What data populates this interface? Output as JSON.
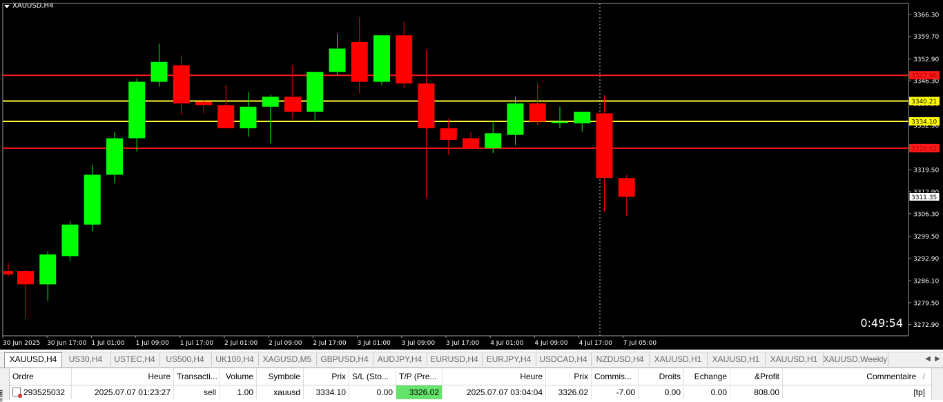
{
  "chart": {
    "symbol_title": "XAUUSD,H4",
    "countdown": "0:49:54",
    "price_axis": {
      "min": 3269.5,
      "max": 3369.6,
      "labels": [
        "3366.30",
        "3359.70",
        "3352.90",
        "3346.30",
        "3339.50",
        "3332.90",
        "3326.10",
        "3319.50",
        "3312.90",
        "3306.30",
        "3299.50",
        "3292.90",
        "3286.10",
        "3279.50",
        "3272.90"
      ]
    },
    "time_labels": [
      "30 Jun 2025",
      "30 Jun 17:00",
      "1 Jul 01:00",
      "1 Jul 09:00",
      "1 Jul 17:00",
      "2 Jul 01:00",
      "2 Jul 09:00",
      "2 Jul 17:00",
      "3 Jul 01:00",
      "3 Jul 09:00",
      "3 Jul 17:00",
      "4 Jul 01:00",
      "4 Jul 09:00",
      "4 Jul 17:00",
      "7 Jul 05:00"
    ],
    "levels": [
      {
        "label": "3347.96",
        "price": 3347.96,
        "color": "#ff1a1a",
        "badge_bg": "#ff1a1a",
        "badge_fg": "#b00000"
      },
      {
        "label": "3340.21",
        "price": 3340.21,
        "color": "#ffff33",
        "badge_bg": "#ffff00",
        "badge_fg": "#000000"
      },
      {
        "label": "3334.10",
        "price": 3334.1,
        "color": "#ffff33",
        "badge_bg": "#ffff00",
        "badge_fg": "#000000"
      },
      {
        "label": "3326.02",
        "price": 3326.02,
        "color": "#ff1a1a",
        "badge_bg": "#ff1a1a",
        "badge_fg": "#b00000"
      }
    ],
    "current_price": {
      "label": "3311.35",
      "price": 3311.35
    },
    "colors": {
      "bull": "#00ff00",
      "bear": "#ff0000",
      "background": "#000000",
      "axis_text": "#ffffff"
    },
    "candles": [
      {
        "o": 3289.0,
        "h": 3291.5,
        "l": 3287.5,
        "c": 3288.0
      },
      {
        "o": 3289.0,
        "h": 3289.5,
        "l": 3275.0,
        "c": 3285.0
      },
      {
        "o": 3285.0,
        "h": 3295.0,
        "l": 3280.0,
        "c": 3294.0
      },
      {
        "o": 3293.5,
        "h": 3304.0,
        "l": 3292.0,
        "c": 3303.0
      },
      {
        "o": 3303.0,
        "h": 3321.0,
        "l": 3301.0,
        "c": 3318.0
      },
      {
        "o": 3318.0,
        "h": 3331.0,
        "l": 3315.5,
        "c": 3329.0
      },
      {
        "o": 3329.0,
        "h": 3347.0,
        "l": 3325.0,
        "c": 3346.0
      },
      {
        "o": 3346.0,
        "h": 3357.5,
        "l": 3344.5,
        "c": 3352.0
      },
      {
        "o": 3351.0,
        "h": 3354.0,
        "l": 3336.0,
        "c": 3339.5
      },
      {
        "o": 3340.0,
        "h": 3340.5,
        "l": 3336.5,
        "c": 3339.0
      },
      {
        "o": 3339.0,
        "h": 3345.0,
        "l": 3332.0,
        "c": 3332.0
      },
      {
        "o": 3332.0,
        "h": 3343.0,
        "l": 3329.5,
        "c": 3338.5
      },
      {
        "o": 3338.5,
        "h": 3342.0,
        "l": 3327.5,
        "c": 3341.5
      },
      {
        "o": 3341.5,
        "h": 3351.0,
        "l": 3335.0,
        "c": 3337.0
      },
      {
        "o": 3337.0,
        "h": 3348.0,
        "l": 3334.0,
        "c": 3349.0
      },
      {
        "o": 3349.0,
        "h": 3360.5,
        "l": 3348.0,
        "c": 3356.0
      },
      {
        "o": 3358.0,
        "h": 3365.5,
        "l": 3342.5,
        "c": 3346.0
      },
      {
        "o": 3346.0,
        "h": 3360.0,
        "l": 3345.0,
        "c": 3360.0
      },
      {
        "o": 3360.0,
        "h": 3364.0,
        "l": 3344.0,
        "c": 3345.5
      },
      {
        "o": 3345.5,
        "h": 3355.5,
        "l": 3311.0,
        "c": 3332.0
      },
      {
        "o": 3332.0,
        "h": 3335.0,
        "l": 3324.0,
        "c": 3328.5
      },
      {
        "o": 3329.0,
        "h": 3331.0,
        "l": 3326.0,
        "c": 3326.0
      },
      {
        "o": 3326.0,
        "h": 3334.0,
        "l": 3324.5,
        "c": 3330.5
      },
      {
        "o": 3330.0,
        "h": 3341.5,
        "l": 3327.0,
        "c": 3339.5
      },
      {
        "o": 3339.5,
        "h": 3345.5,
        "l": 3333.0,
        "c": 3334.0
      },
      {
        "o": 3334.0,
        "h": 3338.5,
        "l": 3332.0,
        "c": 3334.0
      },
      {
        "o": 3333.5,
        "h": 3337.0,
        "l": 3331.0,
        "c": 3337.0
      },
      {
        "o": 3336.5,
        "h": 3342.0,
        "l": 3307.0,
        "c": 3317.0
      },
      {
        "o": 3317.0,
        "h": 3318.0,
        "l": 3305.5,
        "c": 3311.35
      }
    ]
  },
  "tabs": [
    {
      "label": "XAUUSD,H4",
      "active": true
    },
    {
      "label": "US30,H4"
    },
    {
      "label": "USTEC,H4"
    },
    {
      "label": "US500,H4"
    },
    {
      "label": "UK100,H4"
    },
    {
      "label": "XAGUSD,M5"
    },
    {
      "label": "GBPUSD,H4"
    },
    {
      "label": "AUDJPY,H4"
    },
    {
      "label": "EURUSD,H4"
    },
    {
      "label": "EURJPY,H4"
    },
    {
      "label": "USDCAD,H4"
    },
    {
      "label": "NZDUSD,H4"
    },
    {
      "label": "XAUUSD,H1"
    },
    {
      "label": "XAUUSD,H1"
    },
    {
      "label": "XAUUSD,H1"
    },
    {
      "label": "XAUUSD,Weekly"
    }
  ],
  "terminal": {
    "side_label": "inal",
    "columns": [
      "Ordre",
      "Heure",
      "Transacti...",
      "Volume",
      "Symbole",
      "Prix",
      "S/L (Sto...",
      "T/P (Pre...",
      "Heure",
      "Prix",
      "Commis...",
      "Droits",
      "Echange",
      "&Profit",
      "Commentaire"
    ],
    "sort_indicator": "/",
    "row": {
      "ordre": "293525032",
      "heure_open": "2025.07.07 01:23:27",
      "transaction": "sell",
      "volume": "1.00",
      "symbole": "xauusd",
      "prix_open": "3334.10",
      "sl": "0.00",
      "tp": "3326.02",
      "heure_close": "2025.07.07 03:04:04",
      "prix_close": "3326.02",
      "commission": "-7.00",
      "droits": "0.00",
      "echange": "0.00",
      "profit": "808.00",
      "commentaire": "[tp]"
    }
  }
}
